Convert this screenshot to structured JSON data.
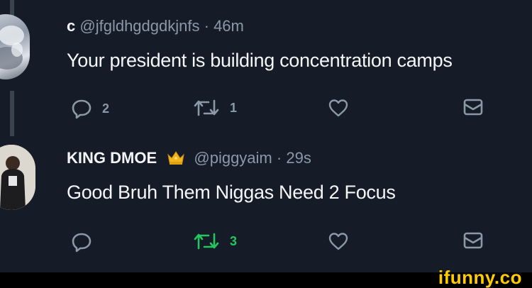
{
  "tweets": [
    {
      "name": "c",
      "handle": "@jfgldhgdgdkjnfs",
      "time": "46m",
      "text": "Your president is building concentration camps",
      "reply_count": "2",
      "retweet_count": "1",
      "retweeted": false
    },
    {
      "name": "KING DMOE",
      "badge": "crown",
      "handle": "@piggyaim",
      "time": "29s",
      "text": "Good Bruh Them Niggas Need 2 Focus",
      "reply_count": "",
      "retweet_count": "3",
      "retweeted": true
    }
  ],
  "watermark": "ifunny.co",
  "colors": {
    "background": "#161c27",
    "muted": "#8b98a6",
    "retweet_active": "#22c55e",
    "watermark": "#ffcc00"
  },
  "icons": [
    "reply-icon",
    "retweet-icon",
    "like-icon",
    "message-icon",
    "crown-icon"
  ]
}
